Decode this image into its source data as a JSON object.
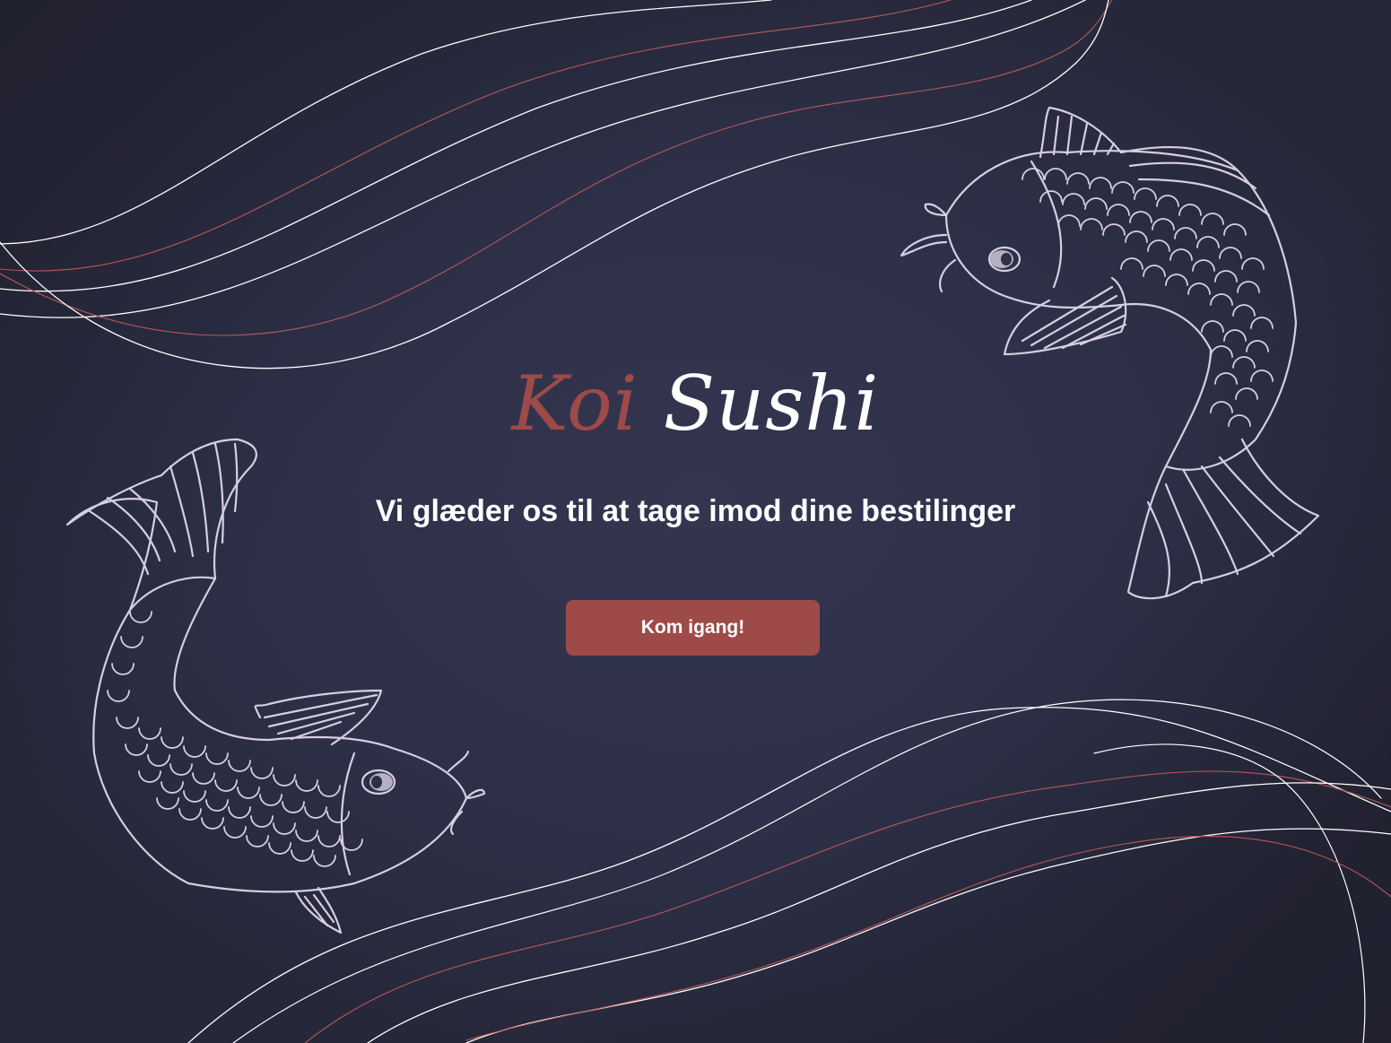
{
  "brand": {
    "name_part1": "Koi",
    "name_part2": "Sushi"
  },
  "hero": {
    "tagline": "Vi glæder os til at tage imod dine bestilinger",
    "cta_label": "Kom igang!"
  },
  "colors": {
    "background": "#2e3049",
    "accent": "#9e4a49",
    "text": "#ffffff",
    "line_art": "#d6cfe0"
  },
  "icons": [
    "koi-fish-icon",
    "wave-lines-decoration"
  ]
}
